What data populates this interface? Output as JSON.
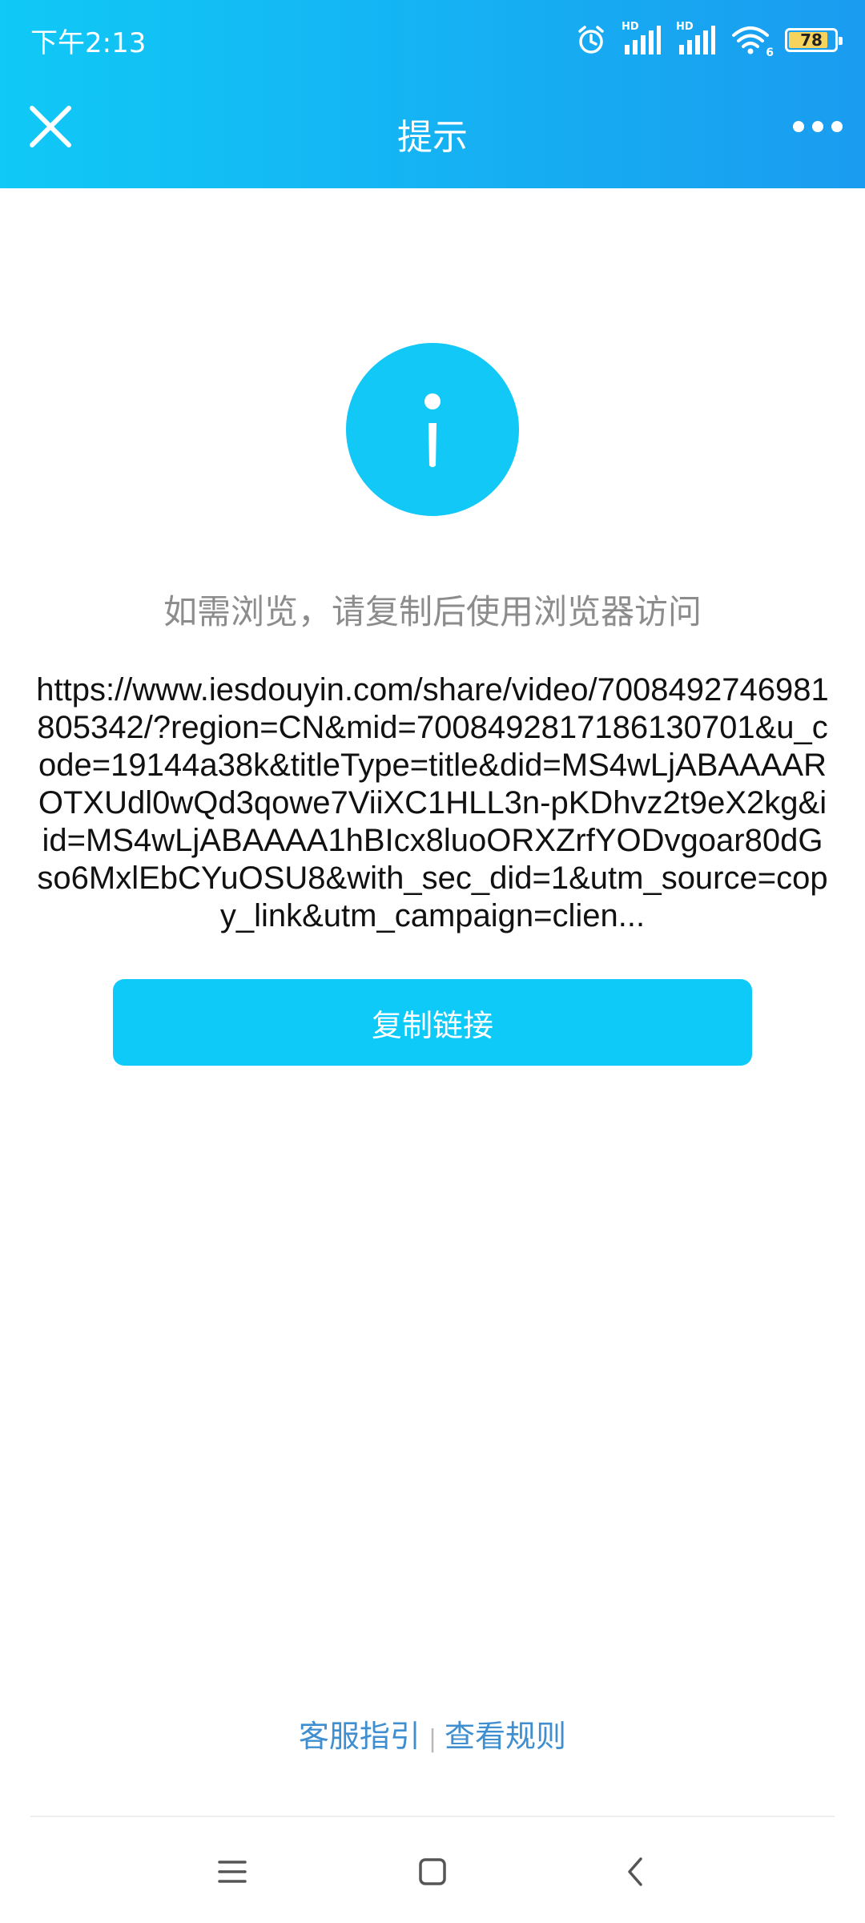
{
  "status_bar": {
    "time": "下午2:13",
    "battery_level": "78",
    "network_label_1": "HD",
    "network_label_2": "HD",
    "wifi_label": "6"
  },
  "nav": {
    "title": "提示",
    "close_icon": "close-icon",
    "more_icon": "more-dots-icon"
  },
  "content": {
    "icon": "info-icon",
    "hint": "如需浏览，请复制后使用浏览器访问",
    "url": "https://www.iesdouyin.com/share/video/7008492746981805342/?region=CN&mid=7008492817186130701&u_code=19144a38k&titleType=title&did=MS4wLjABAAAAROTXUdl0wQd3qowe7ViiXC1HLL3n-pKDhvz2t9eX2kg&iid=MS4wLjABAAAA1hBIcx8luoORXZrfYODvgoar80dGso6MxlEbCYuOSU8&with_sec_did=1&utm_source=copy_link&utm_campaign=clien...",
    "copy_button_label": "复制链接"
  },
  "footer": {
    "link_service": "客服指引",
    "separator": "|",
    "link_rules": "查看规则"
  },
  "colors": {
    "header_start": "#10c9f6",
    "header_end": "#1a9cf0",
    "accent": "#0dcaf8",
    "link": "#3f8fd0",
    "hint_text": "#8c8c8c"
  }
}
